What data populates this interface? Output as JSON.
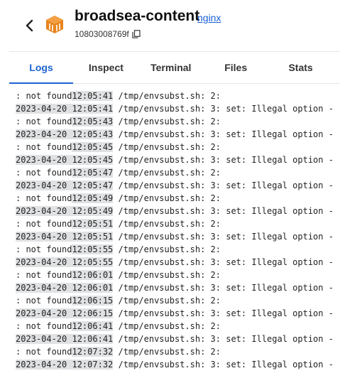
{
  "header": {
    "title": "broadsea-content",
    "image_link": "nginx",
    "container_id": "10803008769f",
    "icons": {
      "back": "chevron-left-icon",
      "container": "container-box-icon",
      "copy": "copy-icon"
    },
    "accent_color": "#1d63d2",
    "container_icon_color": "#e8841c"
  },
  "tabs": [
    {
      "label": "Logs",
      "active": true
    },
    {
      "label": "Inspect",
      "active": false
    },
    {
      "label": "Terminal",
      "active": false
    },
    {
      "label": "Files",
      "active": false
    },
    {
      "label": "Stats",
      "active": false
    }
  ],
  "logs": [
    {
      "pre": ": not found",
      "ts": "12:05:41",
      "post": " /tmp/envsubst.sh: 2:"
    },
    {
      "pre": "",
      "ts": "2023-04-20 12:05:41",
      "post": " /tmp/envsubst.sh: 3: set: Illegal option -"
    },
    {
      "pre": ": not found",
      "ts": "12:05:43",
      "post": " /tmp/envsubst.sh: 2:"
    },
    {
      "pre": "",
      "ts": "2023-04-20 12:05:43",
      "post": " /tmp/envsubst.sh: 3: set: Illegal option -"
    },
    {
      "pre": ": not found",
      "ts": "12:05:45",
      "post": " /tmp/envsubst.sh: 2:"
    },
    {
      "pre": "",
      "ts": "2023-04-20 12:05:45",
      "post": " /tmp/envsubst.sh: 3: set: Illegal option -"
    },
    {
      "pre": ": not found",
      "ts": "12:05:47",
      "post": " /tmp/envsubst.sh: 2:"
    },
    {
      "pre": "",
      "ts": "2023-04-20 12:05:47",
      "post": " /tmp/envsubst.sh: 3: set: Illegal option -"
    },
    {
      "pre": ": not found",
      "ts": "12:05:49",
      "post": " /tmp/envsubst.sh: 2:"
    },
    {
      "pre": "",
      "ts": "2023-04-20 12:05:49",
      "post": " /tmp/envsubst.sh: 3: set: Illegal option -"
    },
    {
      "pre": ": not found",
      "ts": "12:05:51",
      "post": " /tmp/envsubst.sh: 2:"
    },
    {
      "pre": "",
      "ts": "2023-04-20 12:05:51",
      "post": " /tmp/envsubst.sh: 3: set: Illegal option -"
    },
    {
      "pre": ": not found",
      "ts": "12:05:55",
      "post": " /tmp/envsubst.sh: 2:"
    },
    {
      "pre": "",
      "ts": "2023-04-20 12:05:55",
      "post": " /tmp/envsubst.sh: 3: set: Illegal option -"
    },
    {
      "pre": ": not found",
      "ts": "12:06:01",
      "post": " /tmp/envsubst.sh: 2:"
    },
    {
      "pre": "",
      "ts": "2023-04-20 12:06:01",
      "post": " /tmp/envsubst.sh: 3: set: Illegal option -"
    },
    {
      "pre": ": not found",
      "ts": "12:06:15",
      "post": " /tmp/envsubst.sh: 2:"
    },
    {
      "pre": "",
      "ts": "2023-04-20 12:06:15",
      "post": " /tmp/envsubst.sh: 3: set: Illegal option -"
    },
    {
      "pre": ": not found",
      "ts": "12:06:41",
      "post": " /tmp/envsubst.sh: 2:"
    },
    {
      "pre": "",
      "ts": "2023-04-20 12:06:41",
      "post": " /tmp/envsubst.sh: 3: set: Illegal option -"
    },
    {
      "pre": ": not found",
      "ts": "12:07:32",
      "post": " /tmp/envsubst.sh: 2:"
    },
    {
      "pre": "",
      "ts": "2023-04-20 12:07:32",
      "post": " /tmp/envsubst.sh: 3: set: Illegal option -"
    }
  ]
}
